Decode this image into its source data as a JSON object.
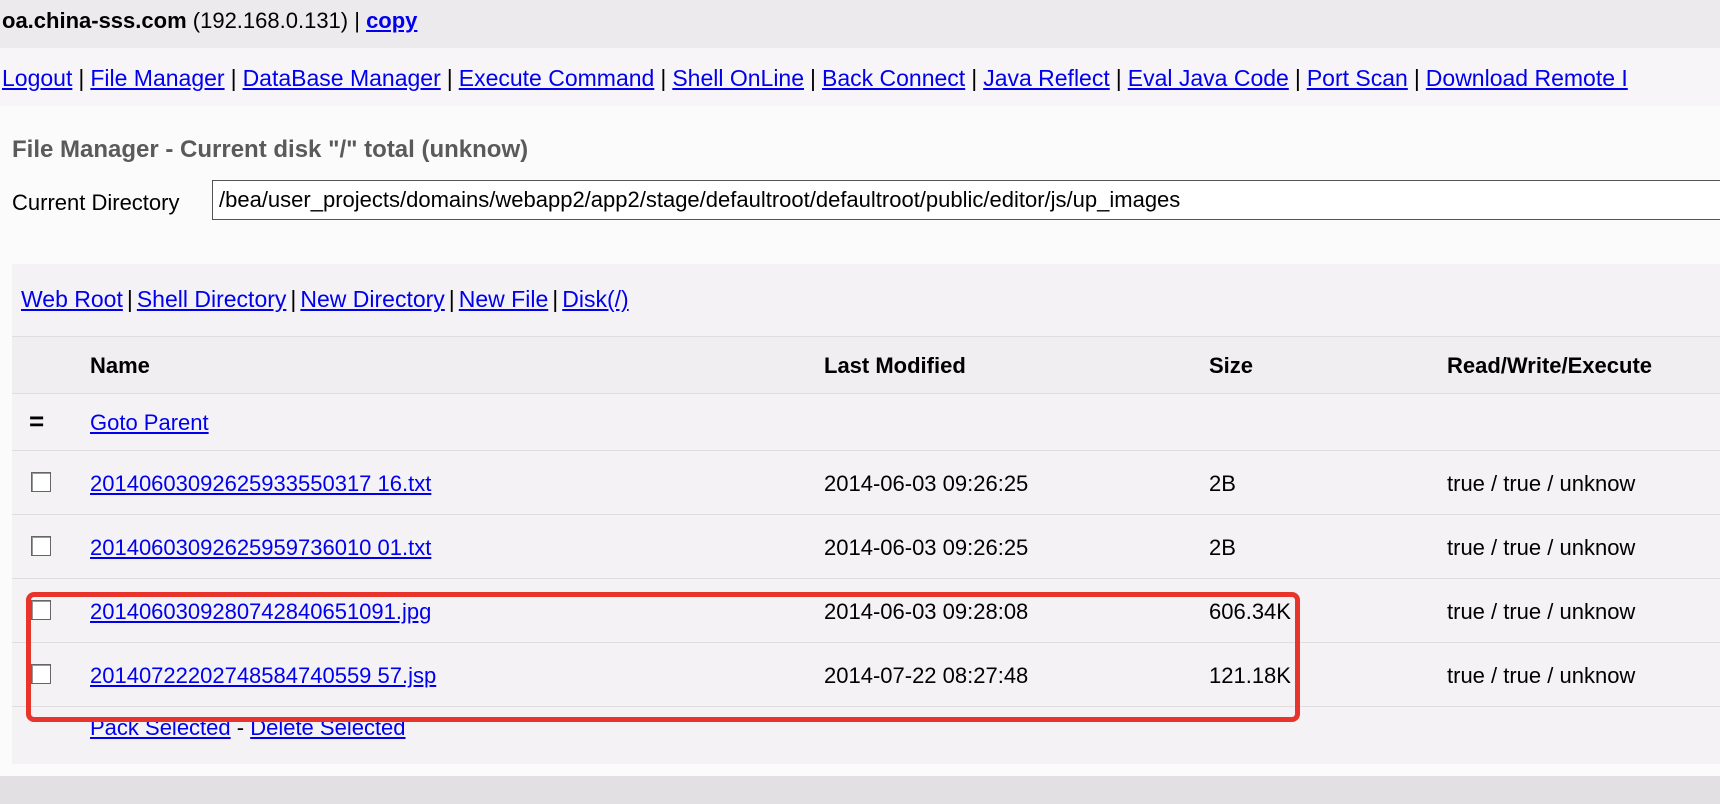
{
  "host": {
    "domain": "oa.china-sss.com",
    "ip_open": " (",
    "ip": "192.168.0.131",
    "ip_close": ") | ",
    "copy_label": "copy"
  },
  "nav": [
    {
      "label": "Logout"
    },
    {
      "label": "File Manager"
    },
    {
      "label": "DataBase Manager"
    },
    {
      "label": "Execute Command"
    },
    {
      "label": "Shell OnLine"
    },
    {
      "label": "Back Connect"
    },
    {
      "label": "Java Reflect"
    },
    {
      "label": "Eval Java Code"
    },
    {
      "label": "Port Scan"
    },
    {
      "label": "Download Remote I"
    }
  ],
  "separator": "|",
  "page_title": "File Manager - Current disk \"/\" total (unknow)",
  "current_directory": {
    "label": "Current Directory",
    "value": "/bea/user_projects/domains/webapp2/app2/stage/defaultroot/defaultroot/public/editor/js/up_images"
  },
  "quick_links": [
    {
      "label": "Web Root"
    },
    {
      "label": "Shell Directory"
    },
    {
      "label": "New Directory"
    },
    {
      "label": "New File"
    },
    {
      "label": "Disk(/)"
    }
  ],
  "table": {
    "headers": {
      "name": "Name",
      "modified": "Last Modified",
      "size": "Size",
      "permissions": "Read/Write/Execute"
    },
    "parent_icon": "=",
    "parent_label": "Goto Parent",
    "rows": [
      {
        "name": "20140603092625933550317 16.txt",
        "modified": "2014-06-03 09:26:25",
        "size": "2B",
        "permissions": "true / true / unknow"
      },
      {
        "name": "20140603092625959736010 01.txt",
        "modified": "2014-06-03 09:26:25",
        "size": "2B",
        "permissions": "true / true / unknow"
      },
      {
        "name": "2014060309280742840651091.jpg",
        "modified": "2014-06-03 09:28:08",
        "size": "606.34K",
        "permissions": "true / true / unknow"
      },
      {
        "name": "20140722202748584740559 57.jsp",
        "modified": "2014-07-22 08:27:48",
        "size": "121.18K",
        "permissions": "true / true / unknow"
      }
    ],
    "actions": {
      "pack": "Pack Selected",
      "dash": " - ",
      "delete": "Delete Selected"
    }
  },
  "colors": {
    "link": "#0000ee",
    "highlight": "#e8342a",
    "title": "#5a5a5a"
  },
  "icons": {
    "checkbox": "checkbox-icon",
    "parent": "goto-parent-icon"
  }
}
